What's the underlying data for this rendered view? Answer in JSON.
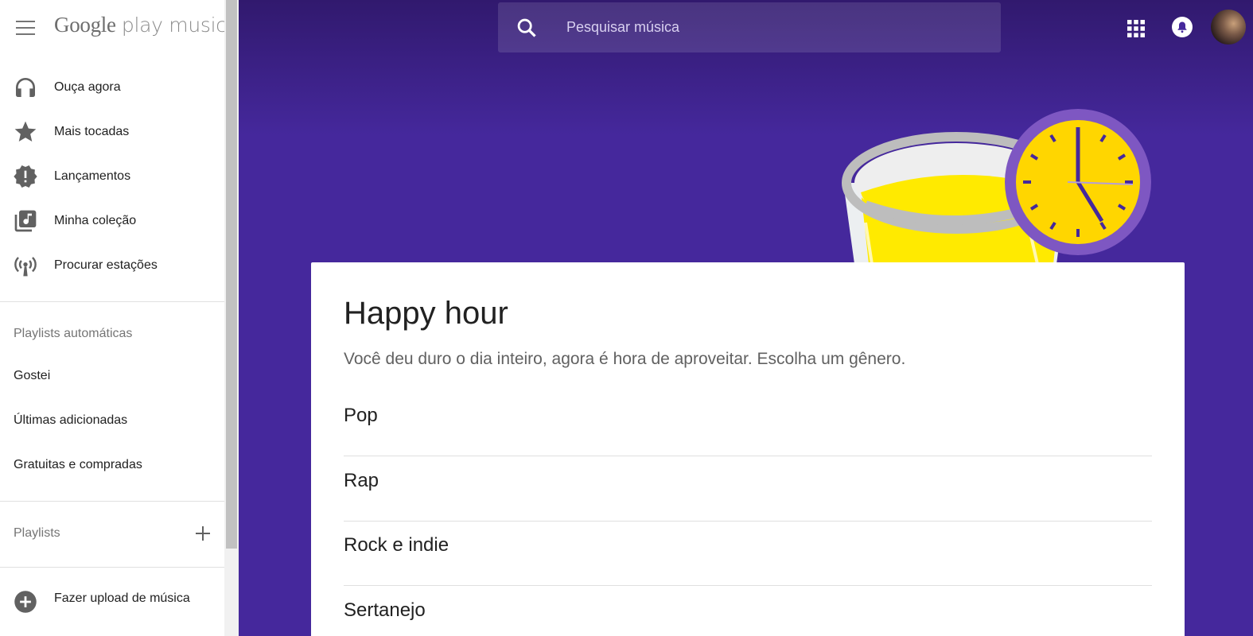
{
  "brand": {
    "google": "Google",
    "product": "play music"
  },
  "nav": {
    "items": [
      {
        "label": "Ouça agora",
        "icon": "headphones-icon"
      },
      {
        "label": "Mais tocadas",
        "icon": "star-icon"
      },
      {
        "label": "Lançamentos",
        "icon": "new-release-icon"
      },
      {
        "label": "Minha coleção",
        "icon": "library-music-icon"
      },
      {
        "label": "Procurar estações",
        "icon": "radio-station-icon"
      }
    ]
  },
  "auto_playlists": {
    "title": "Playlists automáticas",
    "items": [
      "Gostei",
      "Últimas adicionadas",
      "Gratuitas e compradas"
    ]
  },
  "playlists": {
    "title": "Playlists"
  },
  "upload": {
    "label": "Fazer upload de música"
  },
  "search": {
    "placeholder": "Pesquisar música"
  },
  "card": {
    "title": "Happy hour",
    "subtitle": "Você deu duro o dia inteiro, agora é hora de aproveitar. Escolha um gênero.",
    "genres": [
      "Pop",
      "Rap",
      "Rock e indie",
      "Sertanejo"
    ]
  },
  "colors": {
    "main_bg": "#45289c",
    "main_top": "#31196e",
    "clock_face": "#ffd600",
    "drink": "#ffea00"
  }
}
